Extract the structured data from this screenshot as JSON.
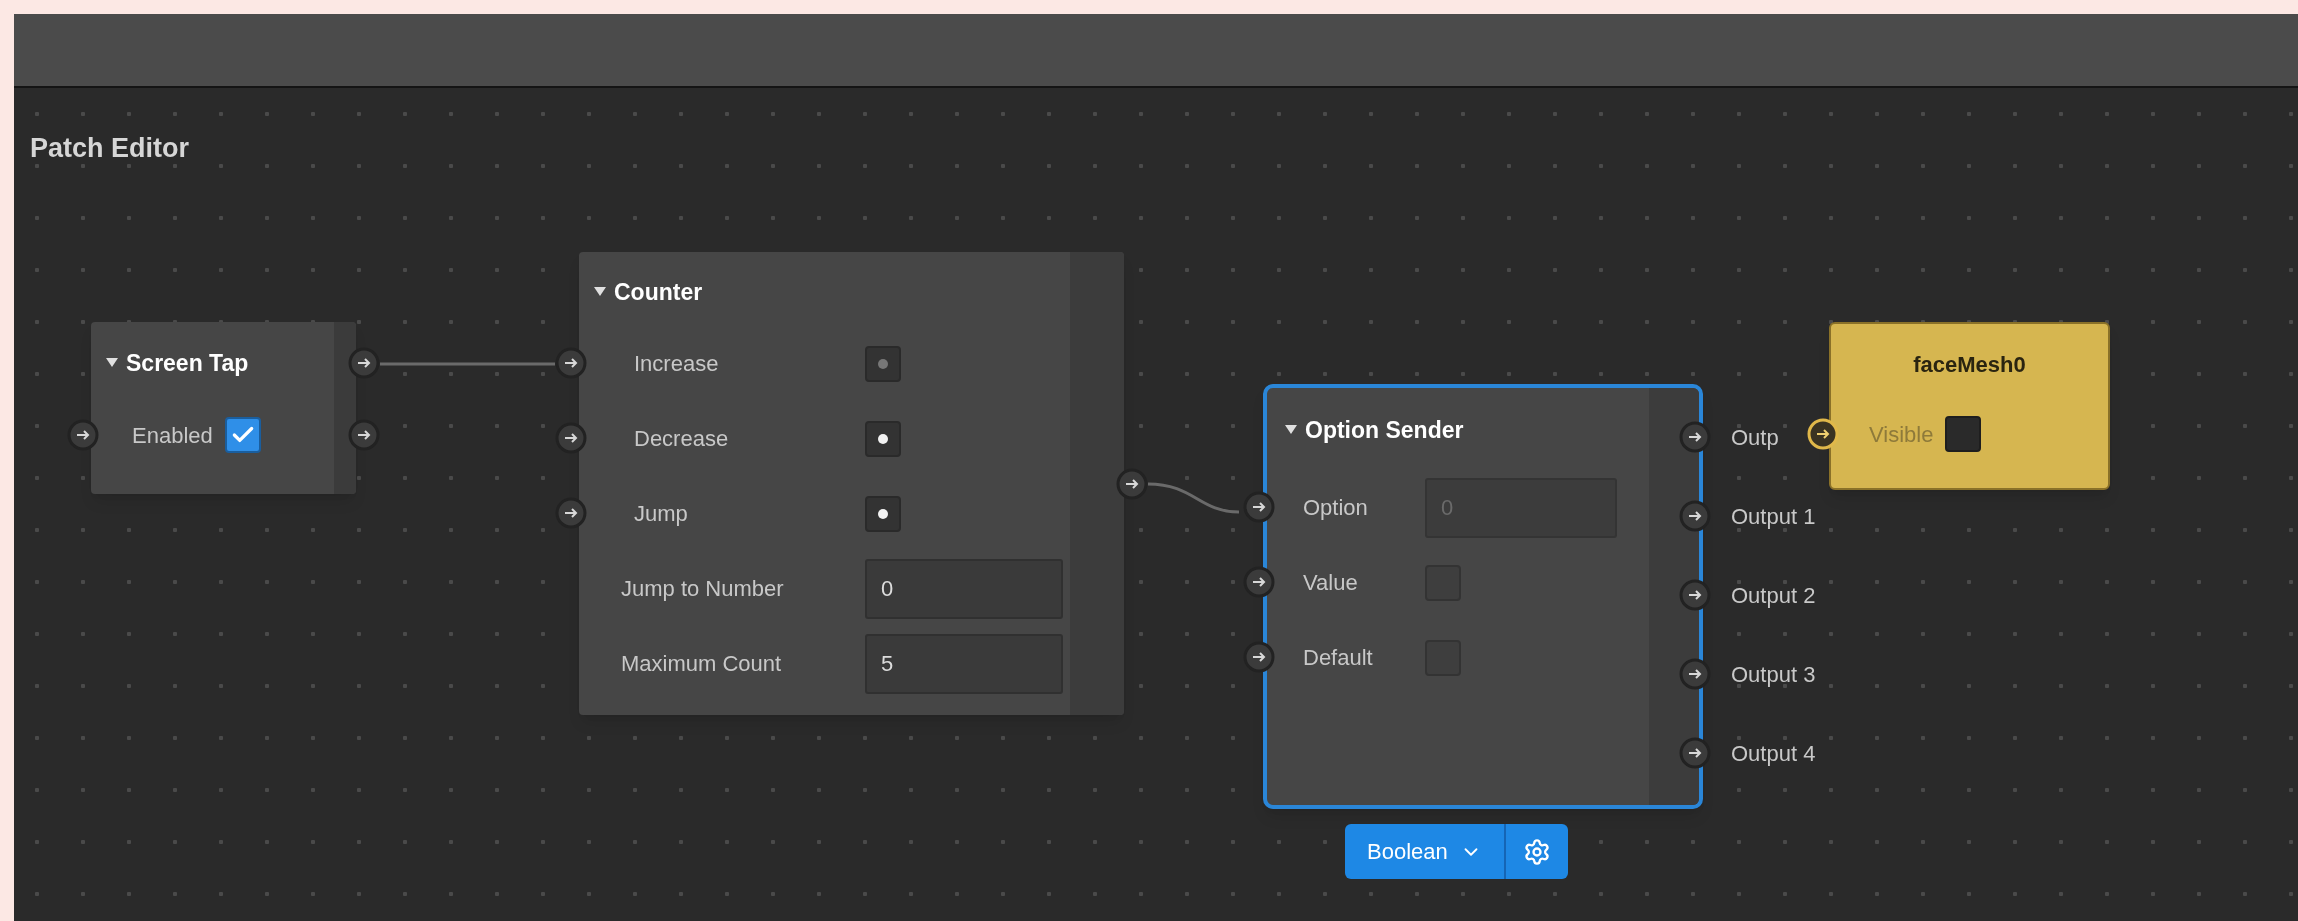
{
  "panel": {
    "title": "Patch Editor"
  },
  "screen_tap": {
    "title": "Screen Tap",
    "enabled": {
      "label": "Enabled",
      "checked": true
    }
  },
  "counter": {
    "title": "Counter",
    "pulses": [
      {
        "label": "Increase",
        "active": false
      },
      {
        "label": "Decrease",
        "active": true
      },
      {
        "label": "Jump",
        "active": true
      }
    ],
    "fields": [
      {
        "label": "Jump to Number",
        "value": "0"
      },
      {
        "label": "Maximum Count",
        "value": "5"
      }
    ]
  },
  "option_sender": {
    "title": "Option Sender",
    "selected": true,
    "option": {
      "label": "Option",
      "value": "0",
      "disabled": true
    },
    "checks": [
      {
        "label": "Value",
        "checked": false
      },
      {
        "label": "Default",
        "checked": false
      }
    ],
    "outputs": [
      "Outp",
      "Output 1",
      "Output 2",
      "Output 3",
      "Output 4"
    ],
    "type_button": "Boolean"
  },
  "face_mesh": {
    "title": "faceMesh0",
    "visible": {
      "label": "Visible",
      "checked": false
    }
  }
}
